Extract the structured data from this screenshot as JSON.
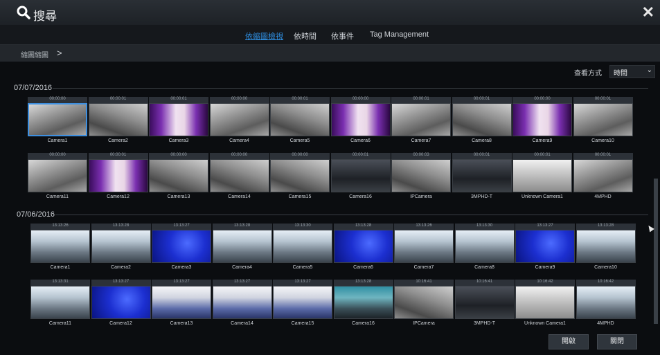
{
  "window": {
    "title": "搜尋",
    "close_label": "✕"
  },
  "tabs": [
    {
      "label": "依縮圖檢視",
      "active": true
    },
    {
      "label": "依時間",
      "active": false
    },
    {
      "label": "依事件",
      "active": false
    },
    {
      "label": "Tag Management",
      "active": false
    }
  ],
  "breadcrumb": {
    "label": "縮圖縮圖",
    "arrow": ">"
  },
  "view": {
    "label": "查看方式",
    "selected": "時間"
  },
  "groups": [
    {
      "date": "07/07/2016",
      "rows": [
        [
          {
            "ts": "00:00:00",
            "label": "Camera1",
            "style": "gray",
            "selected": true
          },
          {
            "ts": "00:00:01",
            "label": "Camera2",
            "style": "gray2"
          },
          {
            "ts": "00:00:01",
            "label": "Camera3",
            "style": "purple"
          },
          {
            "ts": "00:00:00",
            "label": "Camera4",
            "style": "gray"
          },
          {
            "ts": "00:00:01",
            "label": "Camera5",
            "style": "gray2"
          },
          {
            "ts": "00:00:00",
            "label": "Camera6",
            "style": "purple"
          },
          {
            "ts": "00:00:01",
            "label": "Camera7",
            "style": "gray"
          },
          {
            "ts": "00:00:01",
            "label": "Camera8",
            "style": "gray2"
          },
          {
            "ts": "00:00:00",
            "label": "Camera9",
            "style": "purple"
          },
          {
            "ts": "00:00:01",
            "label": "Camera10",
            "style": "gray"
          }
        ],
        [
          {
            "ts": "00:00:00",
            "label": "Camera11",
            "style": "gray"
          },
          {
            "ts": "00:00:01",
            "label": "Camera12",
            "style": "purple"
          },
          {
            "ts": "00:00:00",
            "label": "Camera13",
            "style": "gray2"
          },
          {
            "ts": "00:00:00",
            "label": "Camera14",
            "style": "gray2"
          },
          {
            "ts": "00:00:00",
            "label": "Camera15",
            "style": "gray2"
          },
          {
            "ts": "00:00:01",
            "label": "Camera16",
            "style": "dark"
          },
          {
            "ts": "00:00:03",
            "label": "IPCamera",
            "style": "gray2"
          },
          {
            "ts": "00:00:01",
            "label": "3MPHD-T",
            "style": "dark"
          },
          {
            "ts": "00:00:01",
            "label": "Unknown Camera1",
            "style": "light"
          },
          {
            "ts": "00:00:01",
            "label": "4MPHD",
            "style": "gray"
          }
        ]
      ]
    },
    {
      "date": "07/06/2016",
      "rows": [
        [
          {
            "ts": "13:13:26",
            "label": "Camera1",
            "style": "office"
          },
          {
            "ts": "13:13:28",
            "label": "Camera2",
            "style": "office"
          },
          {
            "ts": "13:13:27",
            "label": "Camera3",
            "style": "blue"
          },
          {
            "ts": "13:13:28",
            "label": "Camera4",
            "style": "office"
          },
          {
            "ts": "13:13:30",
            "label": "Camera5",
            "style": "office"
          },
          {
            "ts": "13:13:28",
            "label": "Camera6",
            "style": "blue"
          },
          {
            "ts": "13:13:26",
            "label": "Camera7",
            "style": "office"
          },
          {
            "ts": "13:13:30",
            "label": "Camera8",
            "style": "office"
          },
          {
            "ts": "13:13:27",
            "label": "Camera9",
            "style": "blue"
          },
          {
            "ts": "13:13:28",
            "label": "Camera10",
            "style": "office"
          }
        ],
        [
          {
            "ts": "13:13:31",
            "label": "Camera11",
            "style": "office"
          },
          {
            "ts": "13:13:27",
            "label": "Camera12",
            "style": "blue"
          },
          {
            "ts": "13:13:27",
            "label": "Camera13",
            "style": "hall"
          },
          {
            "ts": "13:13:27",
            "label": "Camera14",
            "style": "hall"
          },
          {
            "ts": "13:13:27",
            "label": "Camera15",
            "style": "hall"
          },
          {
            "ts": "13:13:28",
            "label": "Camera16",
            "style": "shop"
          },
          {
            "ts": "10:16:41",
            "label": "IPCamera",
            "style": "gray2"
          },
          {
            "ts": "10:16:41",
            "label": "3MPHD-T",
            "style": "dark"
          },
          {
            "ts": "10:16:42",
            "label": "Unknown Camera1",
            "style": "light"
          },
          {
            "ts": "10:16:42",
            "label": "4MPHD",
            "style": "office"
          }
        ]
      ]
    }
  ],
  "buttons": {
    "open": "開啟",
    "close": "關閉"
  },
  "colors": {
    "accent": "#2f8ee0",
    "background": "#0b0d10"
  }
}
